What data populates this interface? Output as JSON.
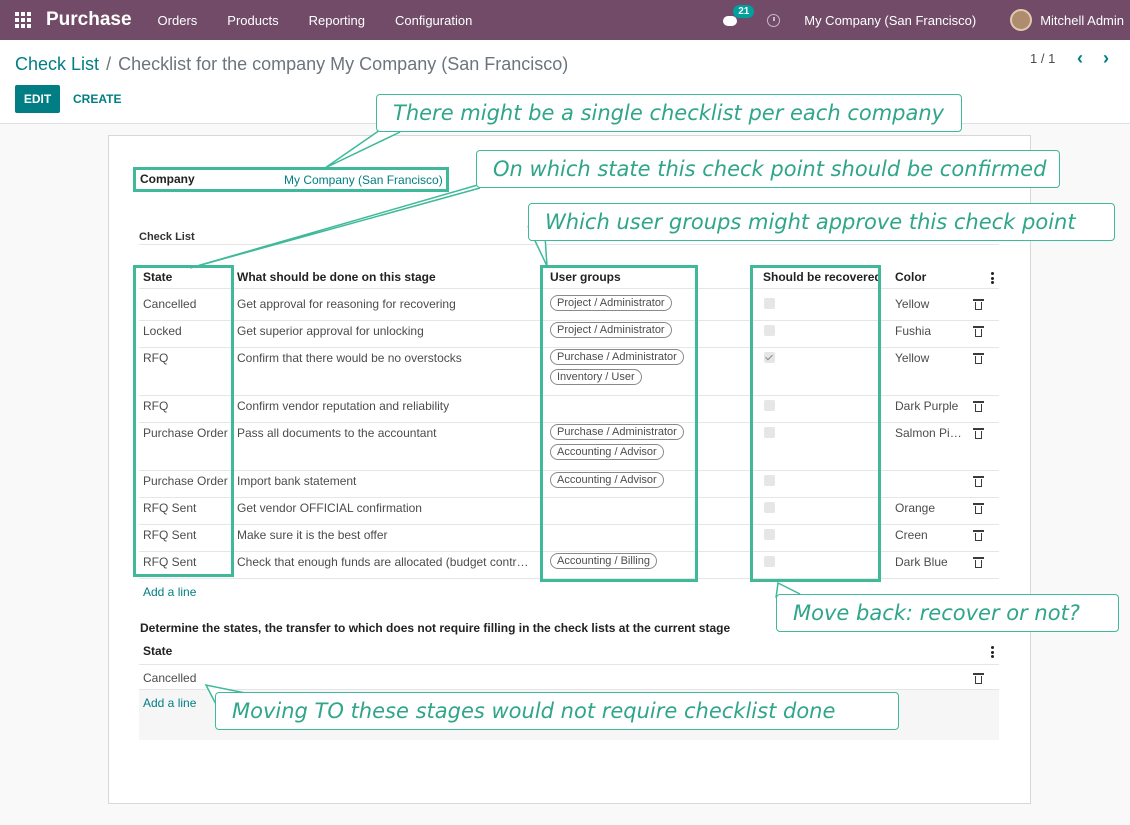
{
  "navbar": {
    "app_name": "Purchase",
    "menu": [
      "Orders",
      "Products",
      "Reporting",
      "Configuration"
    ],
    "chat_badge": "21",
    "company": "My Company (San Francisco)",
    "user": "Mitchell Admin",
    "accent": "#714B67"
  },
  "breadcrumb": {
    "parent": "Check List",
    "separator": "/",
    "current": "Checklist for the company My Company (San Francisco)"
  },
  "actions": {
    "edit": "EDIT",
    "create": "CREATE"
  },
  "pager": {
    "text": "1 / 1",
    "prev": "‹",
    "next": "›"
  },
  "form": {
    "company_label": "Company",
    "company_value": "My Company (San Francisco)",
    "checklist_label": "Check List",
    "columns": [
      "State",
      "What should be done on this stage",
      "User groups",
      "Should be recovered",
      "Color"
    ],
    "rows": [
      {
        "state": "Cancelled",
        "task": "Get approval for reasoning for recovering",
        "groups": [
          "Project / Administrator"
        ],
        "recovered": false,
        "color": "Yellow"
      },
      {
        "state": "Locked",
        "task": "Get superior approval for unlocking",
        "groups": [
          "Project / Administrator"
        ],
        "recovered": false,
        "color": "Fushia"
      },
      {
        "state": "RFQ",
        "task": "Confirm that there would be no overstocks",
        "groups": [
          "Purchase / Administrator",
          "Inventory / User"
        ],
        "recovered": true,
        "color": "Yellow"
      },
      {
        "state": "RFQ",
        "task": "Confirm vendor reputation and reliability",
        "groups": [],
        "recovered": false,
        "color": "Dark Purple"
      },
      {
        "state": "Purchase Order",
        "task": "Pass all documents to the accountant",
        "groups": [
          "Purchase / Administrator",
          "Accounting / Advisor"
        ],
        "recovered": false,
        "color": "Salmon Pi…"
      },
      {
        "state": "Purchase Order",
        "task": "Import bank statement",
        "groups": [
          "Accounting / Advisor"
        ],
        "recovered": false,
        "color": ""
      },
      {
        "state": "RFQ Sent",
        "task": "Get vendor OFFICIAL confirmation",
        "groups": [],
        "recovered": false,
        "color": "Orange"
      },
      {
        "state": "RFQ Sent",
        "task": "Make sure it is the best offer",
        "groups": [],
        "recovered": false,
        "color": "Creen"
      },
      {
        "state": "RFQ Sent",
        "task": "Check that enough funds are allocated (budget contr…",
        "groups": [
          "Accounting / Billing"
        ],
        "recovered": false,
        "color": "Dark Blue"
      }
    ],
    "add_line": "Add a line",
    "lower_title": "Determine the states, the transfer to which does not require filling in the check lists at the current stage",
    "lower_column": "State",
    "lower_rows": [
      "Cancelled"
    ],
    "lower_add_line": "Add a line"
  },
  "annotations": {
    "color": "#3fb99a",
    "company": "There might be a single checklist per each company",
    "state": "On which state this check point should be confirmed",
    "groups": "Which user groups might approve this check point",
    "recover": "Move back: recover or not?",
    "lower": "Moving TO these stages would not require checklist done"
  }
}
